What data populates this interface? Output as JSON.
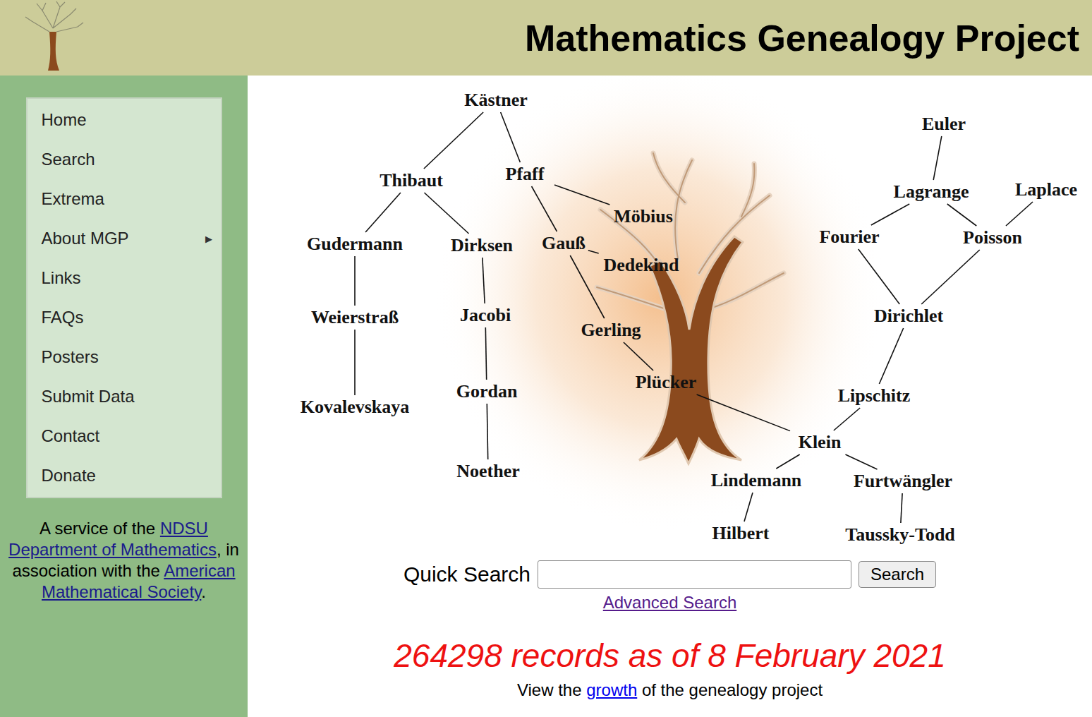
{
  "header": {
    "title": "Mathematics Genealogy Project"
  },
  "sidebar": {
    "items": [
      {
        "label": "Home",
        "submenu": false
      },
      {
        "label": "Search",
        "submenu": false
      },
      {
        "label": "Extrema",
        "submenu": false
      },
      {
        "label": "About MGP",
        "submenu": true
      },
      {
        "label": "Links",
        "submenu": false
      },
      {
        "label": "FAQs",
        "submenu": false
      },
      {
        "label": "Posters",
        "submenu": false
      },
      {
        "label": "Submit Data",
        "submenu": false
      },
      {
        "label": "Contact",
        "submenu": false
      },
      {
        "label": "Donate",
        "submenu": false
      }
    ],
    "submenu_icon": "▶",
    "footer": [
      {
        "text": "A service of the ",
        "link": false
      },
      {
        "text": "NDSU Department of Mathematics",
        "link": true
      },
      {
        "text": ", in association with the ",
        "link": false
      },
      {
        "text": "American Mathematical Society",
        "link": true
      },
      {
        "text": ".",
        "link": false
      }
    ]
  },
  "diagram": {
    "nodes": [
      "Kästner",
      "Thibaut",
      "Pfaff",
      "Möbius",
      "Gudermann",
      "Dirksen",
      "Gauß",
      "Dedekind",
      "Weierstraß",
      "Jacobi",
      "Gerling",
      "Kovalevskaya",
      "Gordan",
      "Plücker",
      "Noether",
      "Euler",
      "Lagrange",
      "Laplace",
      "Fourier",
      "Poisson",
      "Dirichlet",
      "Lipschitz",
      "Klein",
      "Lindemann",
      "Furtwängler",
      "Hilbert",
      "Taussky-Todd"
    ],
    "edges": [
      [
        "Kästner",
        "Thibaut"
      ],
      [
        "Kästner",
        "Pfaff"
      ],
      [
        "Thibaut",
        "Gudermann"
      ],
      [
        "Thibaut",
        "Dirksen"
      ],
      [
        "Pfaff",
        "Möbius"
      ],
      [
        "Pfaff",
        "Gauß"
      ],
      [
        "Gauß",
        "Dedekind"
      ],
      [
        "Gauß",
        "Gerling"
      ],
      [
        "Gudermann",
        "Weierstraß"
      ],
      [
        "Weierstraß",
        "Kovalevskaya"
      ],
      [
        "Dirksen",
        "Jacobi"
      ],
      [
        "Jacobi",
        "Gordan"
      ],
      [
        "Gordan",
        "Noether"
      ],
      [
        "Gerling",
        "Plücker"
      ],
      [
        "Plücker",
        "Klein"
      ],
      [
        "Euler",
        "Lagrange"
      ],
      [
        "Lagrange",
        "Fourier"
      ],
      [
        "Lagrange",
        "Poisson"
      ],
      [
        "Laplace",
        "Poisson"
      ],
      [
        "Fourier",
        "Dirichlet"
      ],
      [
        "Poisson",
        "Dirichlet"
      ],
      [
        "Dirichlet",
        "Lipschitz"
      ],
      [
        "Lipschitz",
        "Klein"
      ],
      [
        "Klein",
        "Lindemann"
      ],
      [
        "Klein",
        "Furtwängler"
      ],
      [
        "Lindemann",
        "Hilbert"
      ],
      [
        "Furtwängler",
        "Taussky-Todd"
      ]
    ]
  },
  "search": {
    "label": "Quick Search",
    "value": "",
    "button": "Search",
    "advanced": "Advanced Search"
  },
  "stats": {
    "records": "264298 records as of 8 February 2021",
    "growth": [
      {
        "text": "View the ",
        "link": false
      },
      {
        "text": "growth",
        "link": true
      },
      {
        "text": " of the genealogy project",
        "link": false
      }
    ]
  }
}
